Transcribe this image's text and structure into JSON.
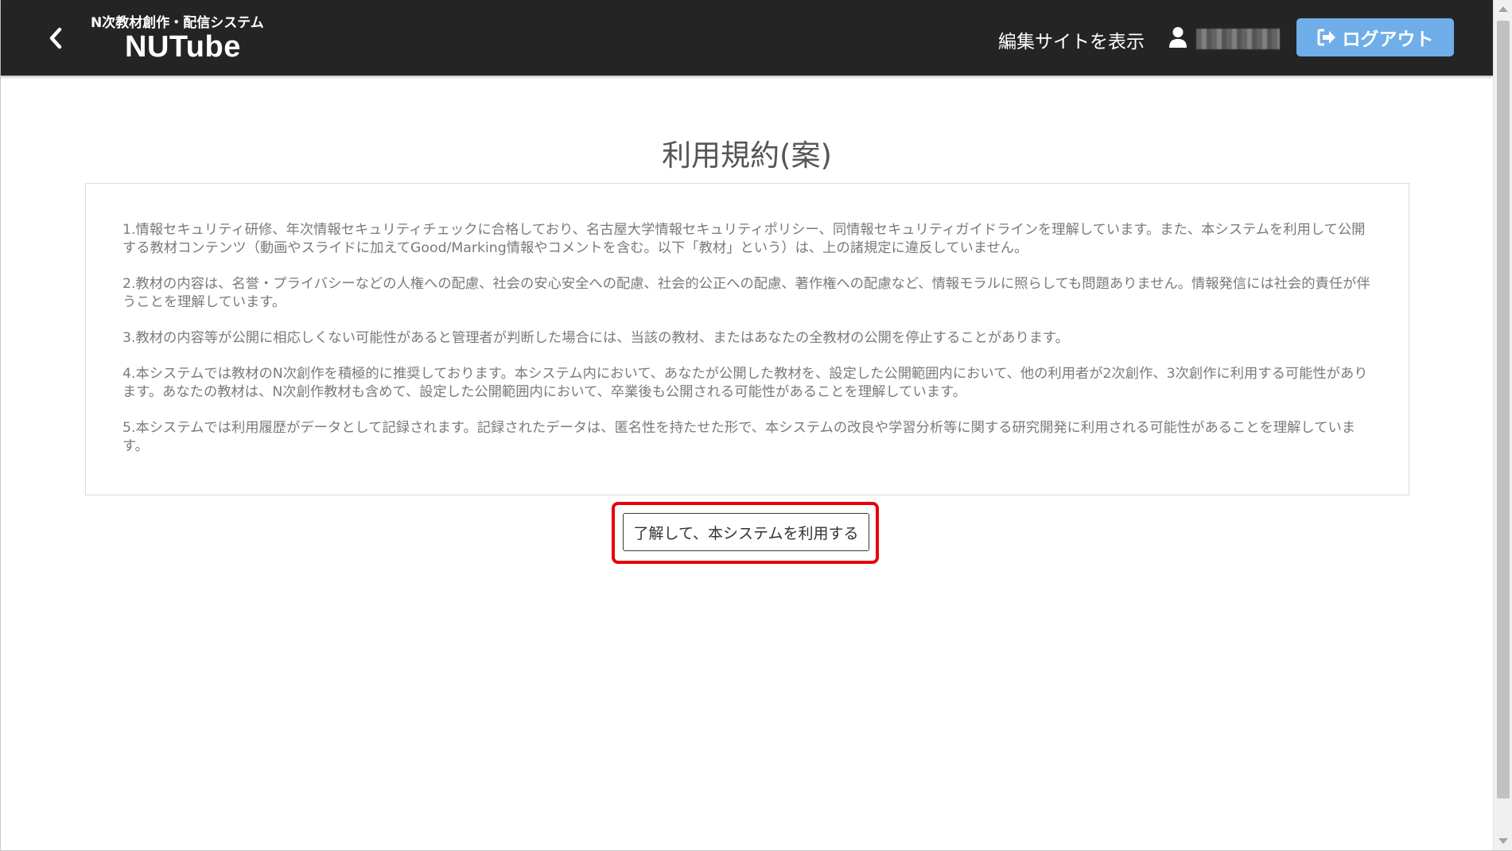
{
  "header": {
    "brand_subtitle": "N次教材創作・配信システム",
    "brand_title": "NUTube",
    "edit_site_link": "編集サイトを表示",
    "logout_label": "ログアウト",
    "logout_color": "#70aee9",
    "header_color": "#242424"
  },
  "page": {
    "title": "利用規約(案)",
    "terms": [
      "1.情報セキュリティ研修、年次情報セキュリティチェックに合格しており、名古屋大学情報セキュリティポリシー、同情報セキュリティガイドラインを理解しています。また、本システムを利用して公開する教材コンテンツ（動画やスライドに加えてGood/Marking情報やコメントを含む。以下「教材」という）は、上の諸規定に違反していません。",
      "2.教材の内容は、名誉・プライバシーなどの人権への配慮、社会の安心安全への配慮、社会的公正への配慮、著作権への配慮など、情報モラルに照らしても問題ありません。情報発信には社会的責任が伴うことを理解しています。",
      "3.教材の内容等が公開に相応しくない可能性があると管理者が判断した場合には、当該の教材、またはあなたの全教材の公開を停止することがあります。",
      "4.本システムでは教材のN次創作を積極的に推奨しております。本システム内において、あなたが公開した教材を、設定した公開範囲内において、他の利用者が2次創作、3次創作に利用する可能性があります。あなたの教材は、N次創作教材も含めて、設定した公開範囲内において、卒業後も公開される可能性があることを理解しています。",
      "5.本システムでは利用履歴がデータとして記録されます。記録されたデータは、匿名性を持たせた形で、本システムの改良や学習分析等に関する研究開発に利用される可能性があることを理解しています。"
    ],
    "agree_button": "了解して、本システムを利用する",
    "highlight_color": "#e8000b"
  }
}
